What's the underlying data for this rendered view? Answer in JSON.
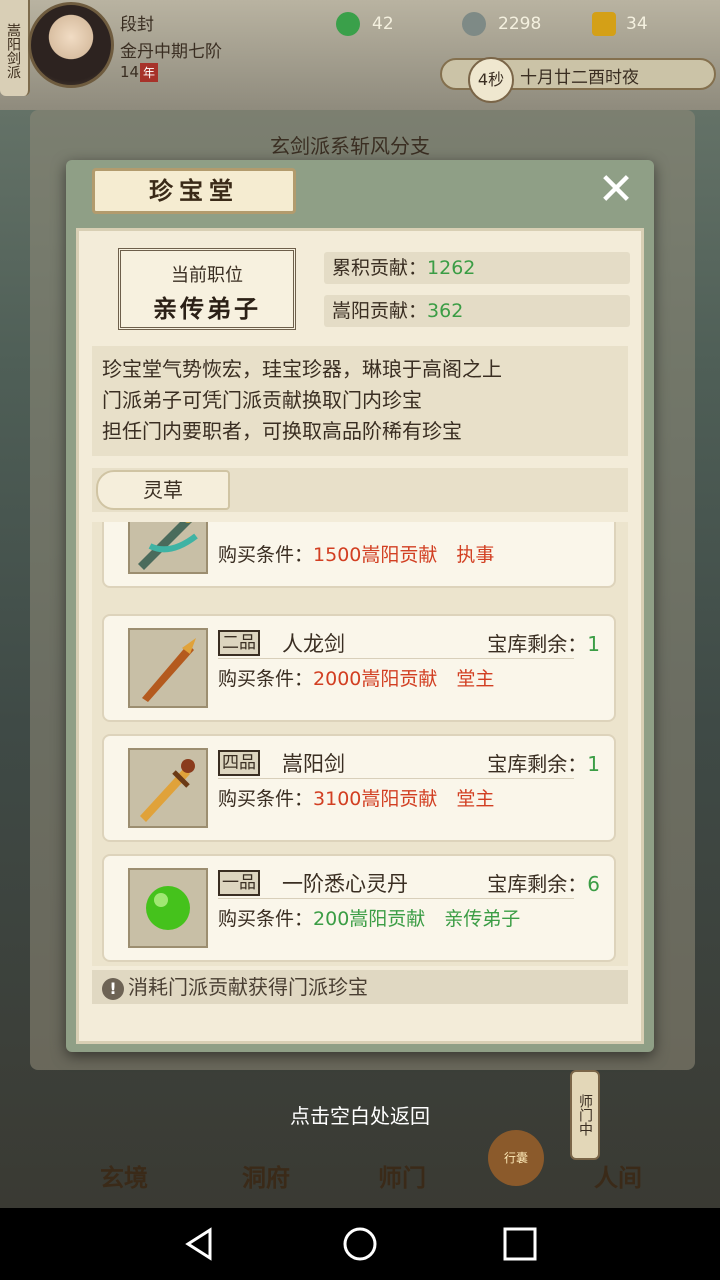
{
  "player": {
    "sect_banner": "嵩阳剑派",
    "name": "段封",
    "realm": "金丹中期七阶",
    "age": "14",
    "age_badge": "年"
  },
  "resources": [
    {
      "icon": "jade-icon",
      "value": "42",
      "color": "#3aa04a"
    },
    {
      "icon": "coin-icon",
      "value": "2298",
      "color": "#7e8a86"
    },
    {
      "icon": "gold-ingot-icon",
      "value": "34",
      "color": "#d4a017"
    }
  ],
  "clock": {
    "countdown": "4秒",
    "date": "十月廿二酉时夜"
  },
  "background": {
    "branch_title": "玄剑派系斩风分支"
  },
  "dialog": {
    "title": "珍宝堂",
    "close_symbol": "✕",
    "position_label": "当前职位",
    "position_value": "亲传弟子",
    "accumulated_label": "累积贡献：",
    "accumulated_value": "1262",
    "songyang_label": "嵩阳贡献：",
    "songyang_value": "362",
    "description": [
      "珍宝堂气势恢宏，珪宝珍器，琳琅于高阁之上",
      "门派弟子可凭门派贡献换取门内珍宝",
      "担任门内要职者，可换取高品阶稀有珍宝"
    ],
    "tab_label": "灵草",
    "tip": "消耗门派贡献获得门派珍宝"
  },
  "items": [
    {
      "grade": "",
      "name": "",
      "stock_label": "",
      "stock": "",
      "cond_label": "购买条件：",
      "cost": "1500嵩阳贡献",
      "req": "执事",
      "status": "red",
      "icon": "jade-sword-icon"
    },
    {
      "grade": "二品",
      "name": "人龙剑",
      "stock_label": "宝库剩余：",
      "stock": "1",
      "cond_label": "购买条件：",
      "cost": "2000嵩阳贡献",
      "req": "堂主",
      "status": "red",
      "icon": "dragon-sword-icon"
    },
    {
      "grade": "四品",
      "name": "嵩阳剑",
      "stock_label": "宝库剩余：",
      "stock": "1",
      "cond_label": "购买条件：",
      "cost": "3100嵩阳贡献",
      "req": "堂主",
      "status": "red",
      "icon": "golden-sword-icon"
    },
    {
      "grade": "一品",
      "name": "一阶悉心灵丹",
      "stock_label": "宝库剩余：",
      "stock": "6",
      "cond_label": "购买条件：",
      "cost": "200嵩阳贡献",
      "req": "亲传弟子",
      "status": "green",
      "icon": "green-pill-icon"
    }
  ],
  "return_hint": "点击空白处返回",
  "nav": {
    "xuanjing": "玄境",
    "dongfu": "洞府",
    "shimen": "师门",
    "renjian": "人间",
    "side_button": "师门中",
    "bag": "行囊"
  },
  "colors": {
    "accent_red": "#d23f22",
    "accent_green": "#3b9d45"
  }
}
